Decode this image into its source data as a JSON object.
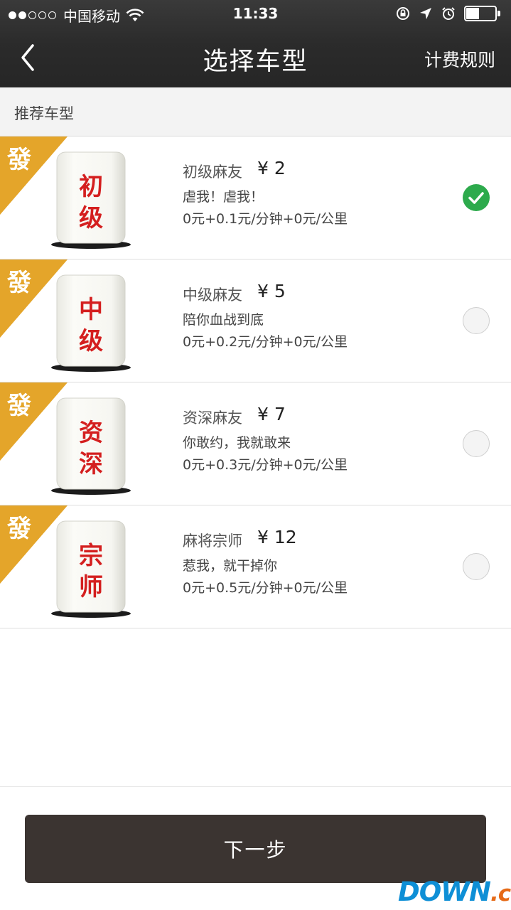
{
  "status_bar": {
    "signal_dots": [
      true,
      true,
      false,
      false,
      false
    ],
    "carrier": "中国移动",
    "time": "11:33"
  },
  "nav": {
    "title": "选择车型",
    "right_label": "计费规则"
  },
  "section": {
    "label": "推荐车型"
  },
  "ribbon_glyph": "發",
  "cars": [
    {
      "tile_text": [
        "初",
        "级"
      ],
      "name": "初级麻友",
      "price": "¥ 2",
      "slogan": "虐我！虐我！",
      "rate": "0元+0.1元/分钟+0元/公里",
      "selected": true
    },
    {
      "tile_text": [
        "中",
        "级"
      ],
      "name": "中级麻友",
      "price": "¥ 5",
      "slogan": "陪你血战到底",
      "rate": "0元+0.2元/分钟+0元/公里",
      "selected": false
    },
    {
      "tile_text": [
        "资",
        "深"
      ],
      "name": "资深麻友",
      "price": "¥ 7",
      "slogan": "你敢约，我就敢来",
      "rate": "0元+0.3元/分钟+0元/公里",
      "selected": false
    },
    {
      "tile_text": [
        "宗",
        "师"
      ],
      "name": "麻将宗师",
      "price": "¥ 12",
      "slogan": "惹我，就干掉你",
      "rate": "0元+0.5元/分钟+0元/公里",
      "selected": false
    }
  ],
  "next_button": "下一步",
  "watermark": {
    "main": "DOWN",
    "suffix": ".cc"
  },
  "colors": {
    "ribbon": "#e4a52a",
    "tile_text": "#d41f1f",
    "check": "#2daa4c",
    "button": "#3b3431",
    "header": "#2b2b2b"
  }
}
